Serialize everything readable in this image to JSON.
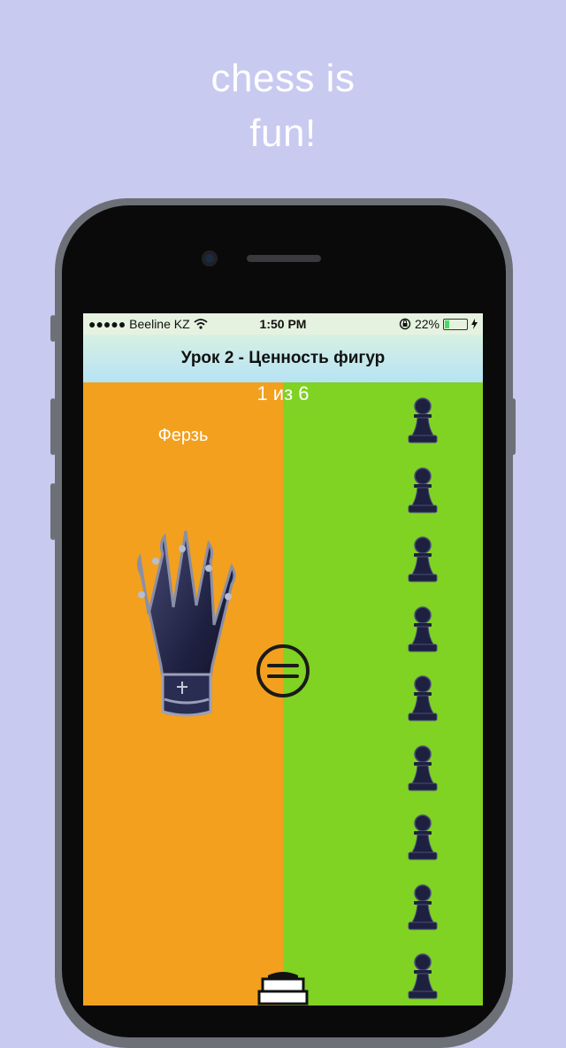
{
  "tagline": {
    "line1": "chess is",
    "line2": "fun!"
  },
  "status_bar": {
    "carrier": "●●●●● Beeline KZ",
    "time": "1:50 PM",
    "battery_percent": "22%",
    "battery_level": 0.22
  },
  "nav": {
    "title": "Урок 2 - Ценность фигур"
  },
  "lesson": {
    "counter": "1 из 6",
    "left_piece_name": "Ферзь",
    "pawn_count": 9
  },
  "colors": {
    "background": "#c9caf0",
    "left_panel": "#f2a01e",
    "right_panel": "#80d223",
    "piece_dark": "#1e2040"
  },
  "icons": [
    "wifi-icon",
    "lock-rotation-icon",
    "battery-icon",
    "charging-icon",
    "queen-icon",
    "equals-icon",
    "pawn-icon",
    "books-icon"
  ]
}
